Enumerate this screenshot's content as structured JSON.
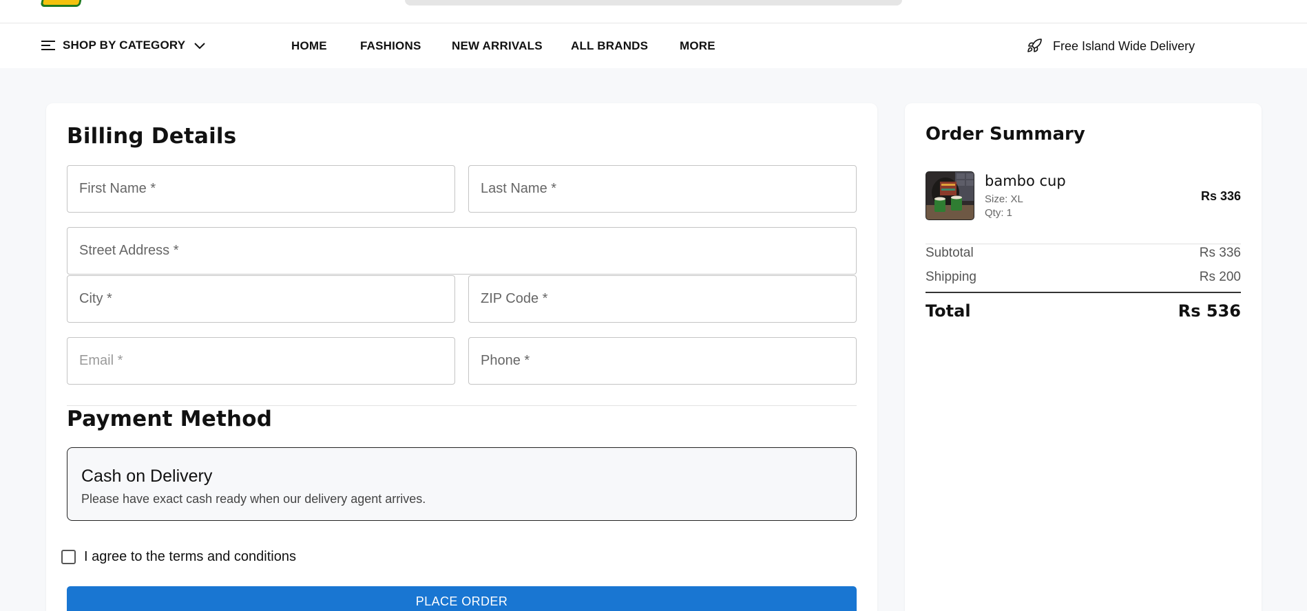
{
  "header": {
    "logo_icon": "store-logo",
    "search_icon": "search-bar"
  },
  "nav": {
    "category_label": "SHOP BY CATEGORY",
    "links": [
      {
        "label": "HOME"
      },
      {
        "label": "FASHIONS"
      },
      {
        "label": "NEW ARRIVALS"
      },
      {
        "label": "ALL BRANDS"
      },
      {
        "label": "MORE"
      }
    ],
    "delivery_text": "Free Island Wide Delivery"
  },
  "billing": {
    "title": "Billing Details",
    "fields": {
      "first_name": {
        "placeholder": "First Name *",
        "value": ""
      },
      "last_name": {
        "placeholder": "Last Name *",
        "value": ""
      },
      "street": {
        "placeholder": "Street Address *",
        "value": ""
      },
      "city": {
        "placeholder": "City *",
        "value": ""
      },
      "zip": {
        "placeholder": "ZIP Code *",
        "value": ""
      },
      "email": {
        "placeholder": "Email *",
        "value": ""
      },
      "phone": {
        "placeholder": "Phone *",
        "value": ""
      }
    }
  },
  "payment": {
    "title": "Payment Method",
    "option_title": "Cash on Delivery",
    "option_desc": "Please have exact cash ready when our delivery agent arrives."
  },
  "terms": {
    "label": "I agree to the terms and conditions",
    "checked": false
  },
  "place_order_label": "PLACE ORDER",
  "summary": {
    "title": "Order Summary",
    "item": {
      "name": "bambo cup",
      "size": "Size: XL",
      "qty": "Qty: 1",
      "price": "Rs 336"
    },
    "subtotal_label": "Subtotal",
    "subtotal_value": "Rs 336",
    "shipping_label": "Shipping",
    "shipping_value": "Rs 200",
    "total_label": "Total",
    "total_value": "Rs 536"
  },
  "colors": {
    "accent": "#1976d2",
    "page_bg": "#f7f8fa"
  }
}
